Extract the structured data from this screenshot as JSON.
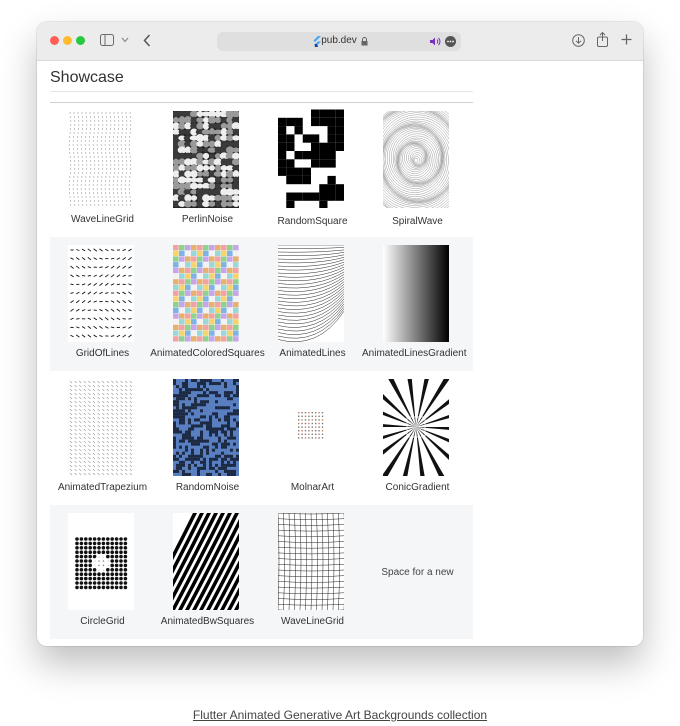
{
  "browser": {
    "url": "pub.dev",
    "icons": [
      "sidebar-icon",
      "chevron-down-icon",
      "back-icon",
      "lock-icon",
      "speaker-icon",
      "more-icon",
      "download-icon",
      "share-icon",
      "plus-icon"
    ]
  },
  "page": {
    "title": "Showcase"
  },
  "showcase": {
    "rows": [
      [
        {
          "label": "WaveLineGrid"
        },
        {
          "label": "PerlinNoise"
        },
        {
          "label": "RandomSquare"
        },
        {
          "label": "SpiralWave"
        }
      ],
      [
        {
          "label": "GridOfLines"
        },
        {
          "label": "AnimatedColoredSquares"
        },
        {
          "label": "AnimatedLines"
        },
        {
          "label": "AnimatedLinesGradient"
        }
      ],
      [
        {
          "label": "AnimatedTrapezium"
        },
        {
          "label": "RandomNoise"
        },
        {
          "label": "MolnarArt"
        },
        {
          "label": "ConicGradient"
        }
      ],
      [
        {
          "label": "CircleGrid"
        },
        {
          "label": "AnimatedBwSquares"
        },
        {
          "label": "WaveLineGrid"
        },
        {
          "placeholder": "Space for a new"
        }
      ]
    ]
  },
  "caption": "Flutter Animated Generative Art Backgrounds collection",
  "colors": {
    "window_bg": "#ffffff",
    "toolbar_bg": "#ececec",
    "alt_row_bg": "#f5f6f8",
    "random_noise_blue": "#5a7fc0"
  }
}
